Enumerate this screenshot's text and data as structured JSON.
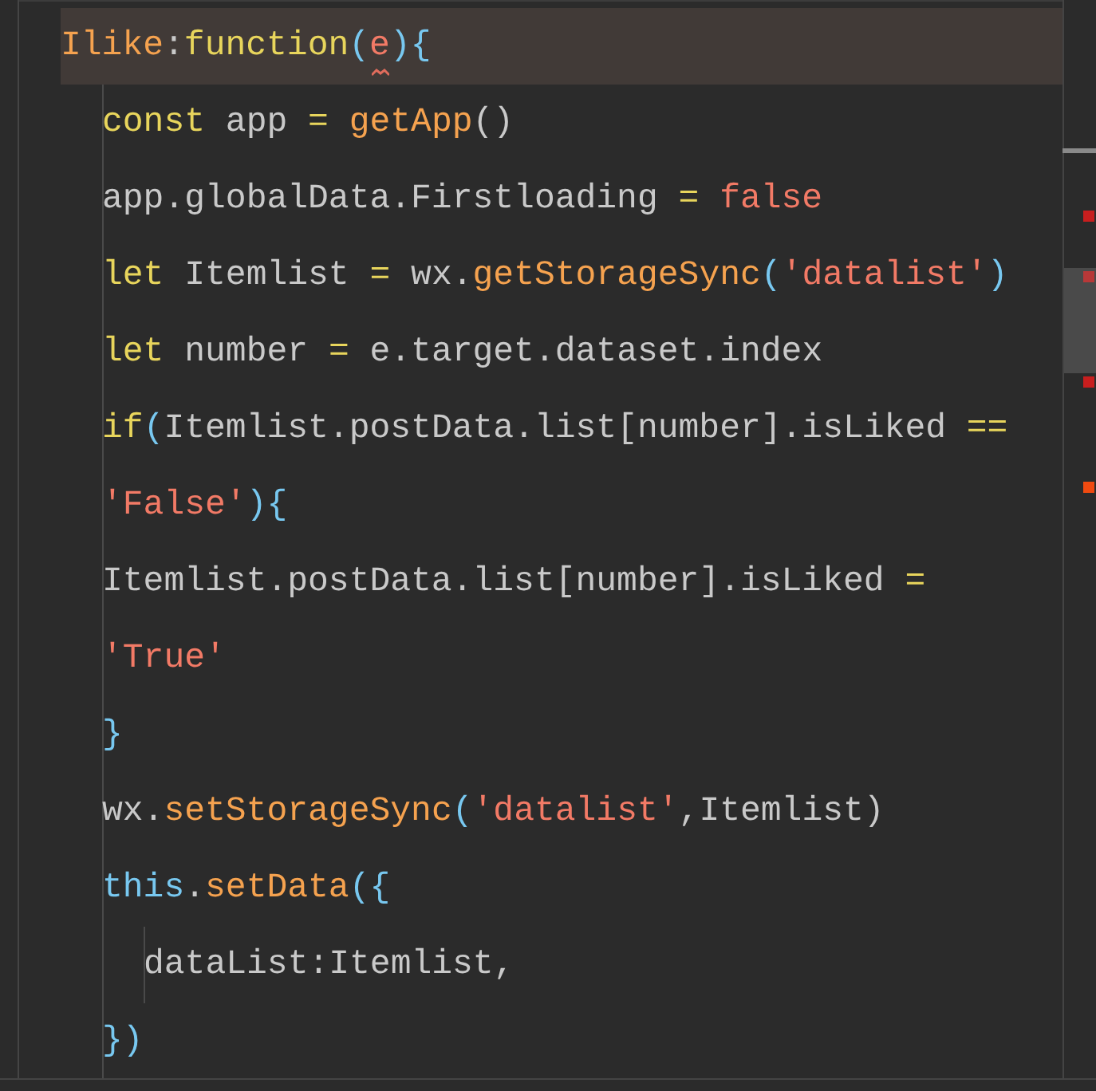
{
  "editor": {
    "lines": [
      {
        "current": true,
        "tokens": [
          {
            "text": "Ilike",
            "kind": "name"
          },
          {
            "text": ":",
            "kind": "plain"
          },
          {
            "text": "function",
            "kind": "keyword"
          },
          {
            "text": "(",
            "kind": "punct"
          },
          {
            "text": "e",
            "kind": "string",
            "squiggle": true
          },
          {
            "text": "){",
            "kind": "punct"
          }
        ],
        "children": [
          {
            "current": false,
            "tokens": [
              {
                "text": "const",
                "kind": "keyword"
              },
              {
                "text": " app ",
                "kind": "plain"
              },
              {
                "text": "=",
                "kind": "keyword"
              },
              {
                "text": " getApp",
                "kind": "name"
              },
              {
                "text": "()",
                "kind": "plain"
              }
            ]
          },
          {
            "current": false,
            "tokens": [
              {
                "text": "app.globalData.Firstloading ",
                "kind": "plain"
              },
              {
                "text": "=",
                "kind": "keyword"
              },
              {
                "text": " false",
                "kind": "string"
              }
            ]
          },
          {
            "current": false,
            "tokens": [
              {
                "text": "let",
                "kind": "keyword"
              },
              {
                "text": " Itemlist ",
                "kind": "plain"
              },
              {
                "text": "=",
                "kind": "keyword"
              },
              {
                "text": " wx.",
                "kind": "plain"
              },
              {
                "text": "getStorageSync",
                "kind": "name"
              },
              {
                "text": "(",
                "kind": "punct"
              },
              {
                "text": "'datalist'",
                "kind": "string"
              },
              {
                "text": ")",
                "kind": "punct"
              }
            ]
          },
          {
            "current": false,
            "tokens": [
              {
                "text": "let",
                "kind": "keyword"
              },
              {
                "text": " number ",
                "kind": "plain"
              },
              {
                "text": "=",
                "kind": "keyword"
              },
              {
                "text": " e.target.dataset.index",
                "kind": "plain"
              }
            ]
          },
          {
            "current": false,
            "tokens": [
              {
                "text": "if",
                "kind": "keyword"
              },
              {
                "text": "(",
                "kind": "punct"
              },
              {
                "text": "Itemlist.postData.list[number].isLiked ",
                "kind": "plain"
              },
              {
                "text": "==",
                "kind": "keyword"
              }
            ]
          },
          {
            "current": false,
            "tokens": [
              {
                "text": "'False'",
                "kind": "string"
              },
              {
                "text": "){",
                "kind": "punct"
              }
            ]
          },
          {
            "current": false,
            "tokens": [
              {
                "text": "Itemlist.postData.list[number].isLiked ",
                "kind": "plain"
              },
              {
                "text": "=",
                "kind": "keyword"
              }
            ]
          },
          {
            "current": false,
            "tokens": [
              {
                "text": "'True'",
                "kind": "string"
              }
            ]
          },
          {
            "current": false,
            "tokens": [
              {
                "text": "}",
                "kind": "punct"
              }
            ]
          },
          {
            "current": false,
            "tokens": [
              {
                "text": "wx.",
                "kind": "plain"
              },
              {
                "text": "setStorageSync",
                "kind": "name"
              },
              {
                "text": "(",
                "kind": "punct"
              },
              {
                "text": "'datalist'",
                "kind": "string"
              },
              {
                "text": ",Itemlist)",
                "kind": "plain"
              }
            ]
          },
          {
            "current": false,
            "tokens": [
              {
                "text": "this",
                "kind": "punct"
              },
              {
                "text": ".",
                "kind": "plain"
              },
              {
                "text": "setData",
                "kind": "name"
              },
              {
                "text": "({",
                "kind": "punct"
              }
            ],
            "children": [
              {
                "current": false,
                "tokens": [
                  {
                    "text": "dataList:Itemlist,",
                    "kind": "plain"
                  }
                ]
              }
            ]
          },
          {
            "current": false,
            "tokens": [
              {
                "text": "})",
                "kind": "punct"
              }
            ]
          }
        ]
      }
    ]
  }
}
